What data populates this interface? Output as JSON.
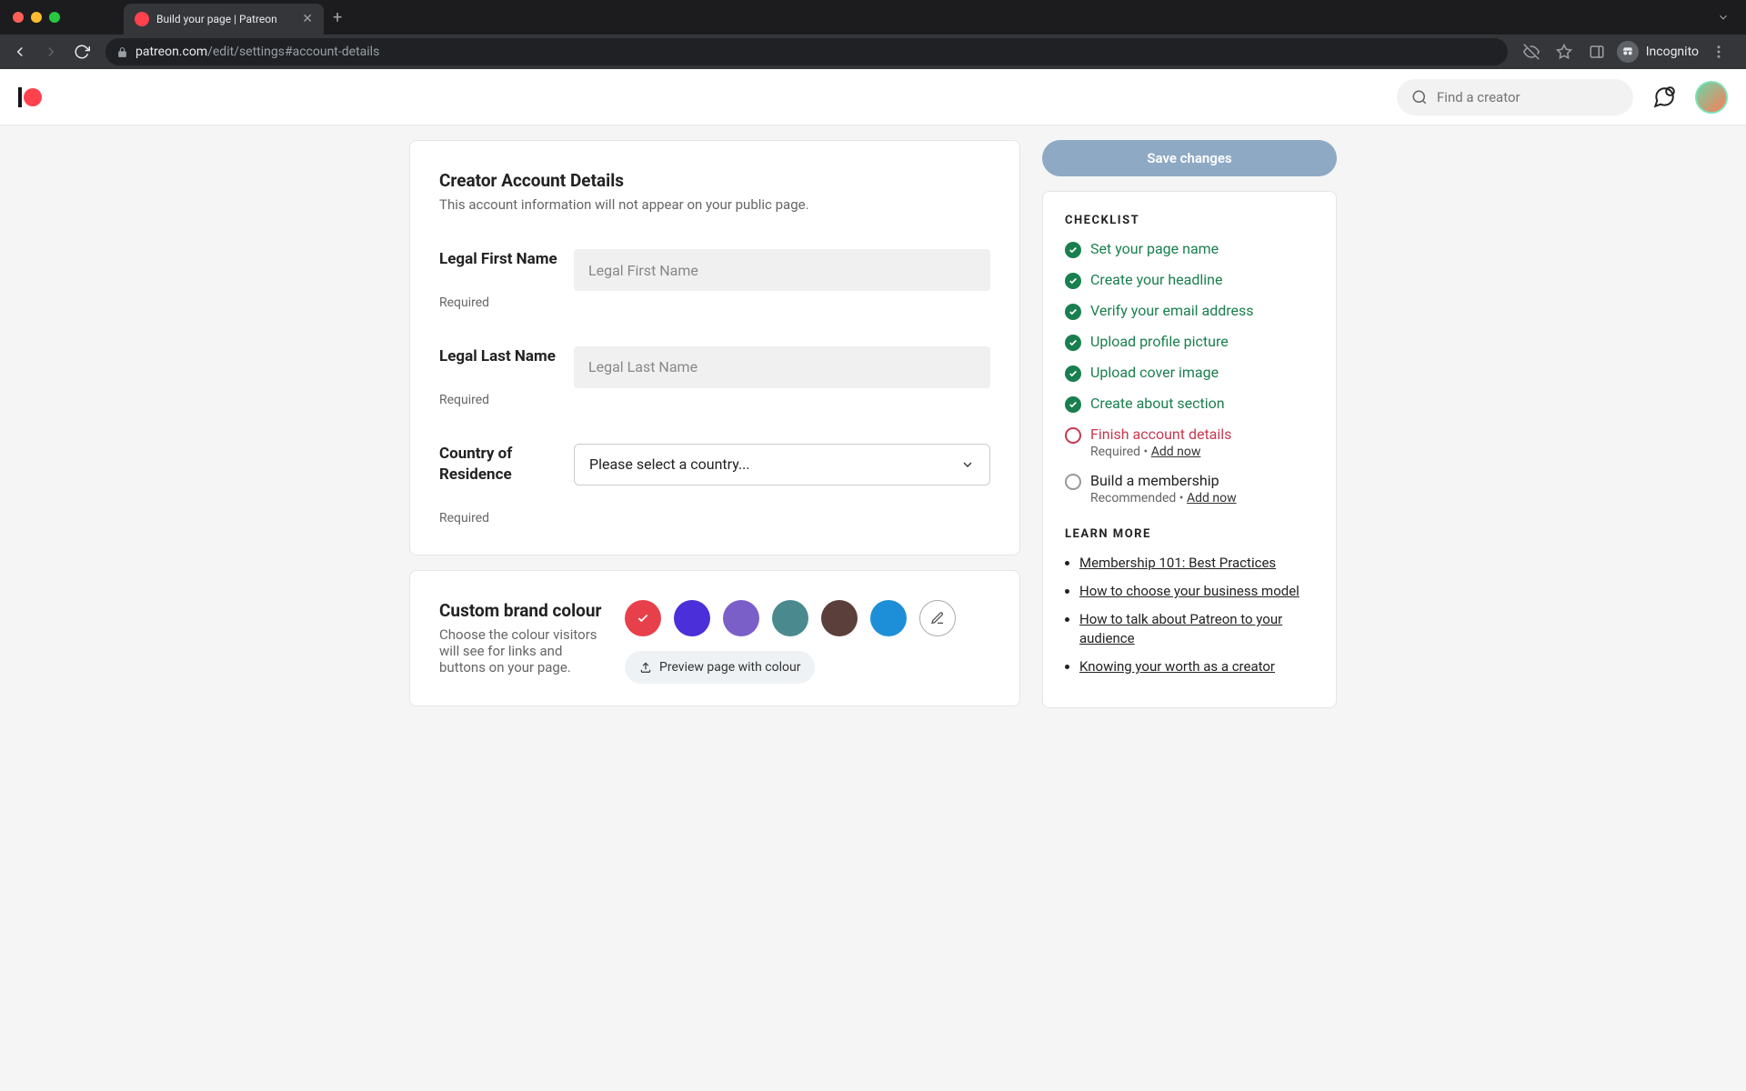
{
  "browser": {
    "tab_title": "Build your page | Patreon",
    "url_domain": "patreon.com",
    "url_path": "/edit/settings#account-details",
    "incognito_label": "Incognito"
  },
  "header": {
    "search_placeholder": "Find a creator"
  },
  "account_card": {
    "title": "Creator Account Details",
    "subtitle": "This account information will not appear on your public page.",
    "first_name_label": "Legal First Name",
    "first_name_placeholder": "Legal First Name",
    "last_name_label": "Legal Last Name",
    "last_name_placeholder": "Legal Last Name",
    "country_label": "Country of Residence",
    "country_placeholder": "Please select a country...",
    "required_text": "Required"
  },
  "brand_card": {
    "title": "Custom brand colour",
    "subtitle": "Choose the colour visitors will see for links and buttons on your page.",
    "preview_label": "Preview page with colour",
    "swatches": [
      "#e8404a",
      "#4b2fd9",
      "#7b5fc9",
      "#4a8a8f",
      "#5a3f3a",
      "#1d8fd8"
    ]
  },
  "save_label": "Save changes",
  "checklist": {
    "heading": "CHECKLIST",
    "items": [
      {
        "label": "Set your page name",
        "done": true
      },
      {
        "label": "Create your headline",
        "done": true
      },
      {
        "label": "Verify your email address",
        "done": true
      },
      {
        "label": "Upload profile picture",
        "done": true
      },
      {
        "label": "Upload cover image",
        "done": true
      },
      {
        "label": "Create about section",
        "done": true
      },
      {
        "label": "Finish account details",
        "done": false,
        "sub_prefix": "Required",
        "sub_link": "Add now",
        "required": true
      },
      {
        "label": "Build a membership",
        "done": false,
        "sub_prefix": "Recommended",
        "sub_link": "Add now",
        "required": false
      }
    ]
  },
  "learn": {
    "heading": "LEARN MORE",
    "links": [
      "Membership 101: Best Practices",
      "How to choose your business model",
      "How to talk about Patreon to your audience",
      "Knowing your worth as a creator"
    ]
  }
}
